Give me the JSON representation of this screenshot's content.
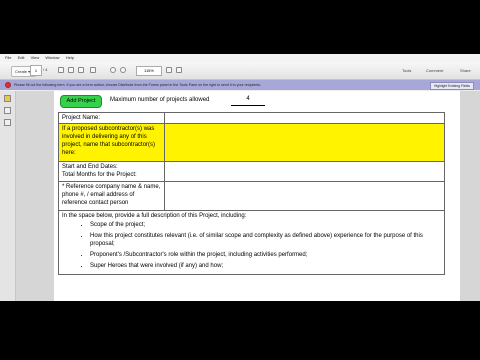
{
  "menu": [
    "File",
    "Edit",
    "View",
    "Window",
    "Help"
  ],
  "toolbar": {
    "create_label": "Create",
    "page_current": "1",
    "page_total": "/ 4",
    "zoom": "115%",
    "tools_label": "Tools",
    "comment_label": "Comment",
    "share_label": "Share"
  },
  "notice": {
    "message": "Please fill out the following form. If you are a form author, choose Distribute from the Forms panel in the Tools Pane on the right to send it to your recipients.",
    "highlight_label": "Highlight Existing Fields"
  },
  "form": {
    "add_project_label": "Add Project",
    "max_label": "Maximum number of projects allowed",
    "max_value": "4",
    "rows": [
      {
        "label": "Project Name:",
        "highlight": false
      },
      {
        "label": "If a proposed subcontractor(s) was involved in delivering any of this project, name that subcontractor(s) here:",
        "highlight": true
      },
      {
        "label": "Start and End Dates:\nTotal Months for the Project:",
        "highlight": false
      },
      {
        "label": "* Reference company name & name, phone #, / email address of reference contact person",
        "highlight": false
      }
    ],
    "description_intro": "In the space below, provide a full description of this Project, including:",
    "bullets": [
      "Scope of the project;",
      "How this project constitutes relevant (i.e. of similar scope and complexity as defined above) experience for the purpose of this proposal;",
      "Proponent's /Subcontractor's role within the project, including activities performed;",
      "Super Heroes that were involved (if any) and how;"
    ]
  },
  "colors": {
    "highlight_yellow": "#fff300",
    "button_green": "#35d14a",
    "notice_bar": "#a8a8d8"
  }
}
